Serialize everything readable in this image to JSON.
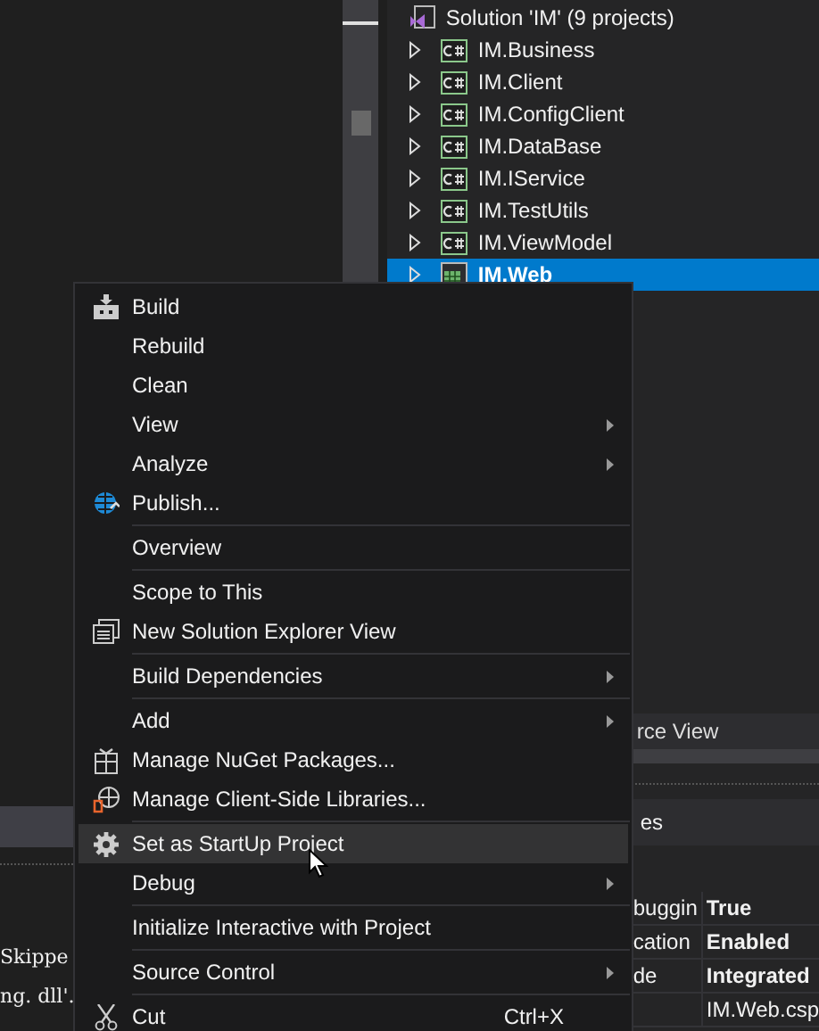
{
  "solution_explorer": {
    "solution": "Solution 'IM' (9 projects)",
    "projects": [
      {
        "name": "IM.Business",
        "kind": "csharp",
        "selected": false
      },
      {
        "name": "IM.Client",
        "kind": "csharp",
        "selected": false
      },
      {
        "name": "IM.ConfigClient",
        "kind": "csharp",
        "selected": false
      },
      {
        "name": "IM.DataBase",
        "kind": "csharp",
        "selected": false
      },
      {
        "name": "IM.IService",
        "kind": "csharp",
        "selected": false
      },
      {
        "name": "IM.TestUtils",
        "kind": "csharp",
        "selected": false
      },
      {
        "name": "IM.ViewModel",
        "kind": "csharp",
        "selected": false
      },
      {
        "name": "IM.Web",
        "kind": "web",
        "selected": true
      }
    ]
  },
  "tab_strip": {
    "tabs": [
      {
        "label": "rce View"
      }
    ]
  },
  "properties": {
    "title": "es",
    "rows": [
      {
        "name": "buggin",
        "value": "True"
      },
      {
        "name": "cation",
        "value": "Enabled"
      },
      {
        "name": "de",
        "value": "Integrated"
      },
      {
        "value": "IM.Web.csp"
      }
    ]
  },
  "output": {
    "lines": [
      "Skippe",
      "ng. dll'."
    ]
  },
  "context_menu": {
    "items": [
      {
        "kind": "command",
        "label": "Build",
        "selected": false
      },
      {
        "kind": "command",
        "label": "Rebuild",
        "selected": false
      },
      {
        "kind": "command",
        "label": "Clean",
        "selected": false
      },
      {
        "kind": "submenu",
        "label": "View",
        "selected": false
      },
      {
        "kind": "submenu",
        "label": "Analyze",
        "selected": false
      },
      {
        "kind": "command",
        "label": "Publish...",
        "selected": false
      },
      {
        "kind": "separator"
      },
      {
        "kind": "command",
        "label": "Overview",
        "selected": false
      },
      {
        "kind": "separator"
      },
      {
        "kind": "command",
        "label": "Scope to This",
        "selected": false
      },
      {
        "kind": "command",
        "label": "New Solution Explorer View",
        "selected": false
      },
      {
        "kind": "separator"
      },
      {
        "kind": "submenu",
        "label": "Build Dependencies",
        "selected": false
      },
      {
        "kind": "separator"
      },
      {
        "kind": "submenu",
        "label": "Add",
        "selected": false
      },
      {
        "kind": "command",
        "label": "Manage NuGet Packages...",
        "selected": false
      },
      {
        "kind": "command",
        "label": "Manage Client-Side Libraries...",
        "selected": false
      },
      {
        "kind": "separator"
      },
      {
        "kind": "command",
        "label": "Set as StartUp Project",
        "selected": true
      },
      {
        "kind": "submenu",
        "label": "Debug",
        "selected": false
      },
      {
        "kind": "separator"
      },
      {
        "kind": "command",
        "label": "Initialize Interactive with Project",
        "selected": false
      },
      {
        "kind": "separator"
      },
      {
        "kind": "submenu",
        "label": "Source Control",
        "selected": false
      },
      {
        "kind": "separator"
      },
      {
        "kind": "command",
        "label": "Cut",
        "shortcut": "Ctrl+X",
        "selected": false
      }
    ]
  }
}
